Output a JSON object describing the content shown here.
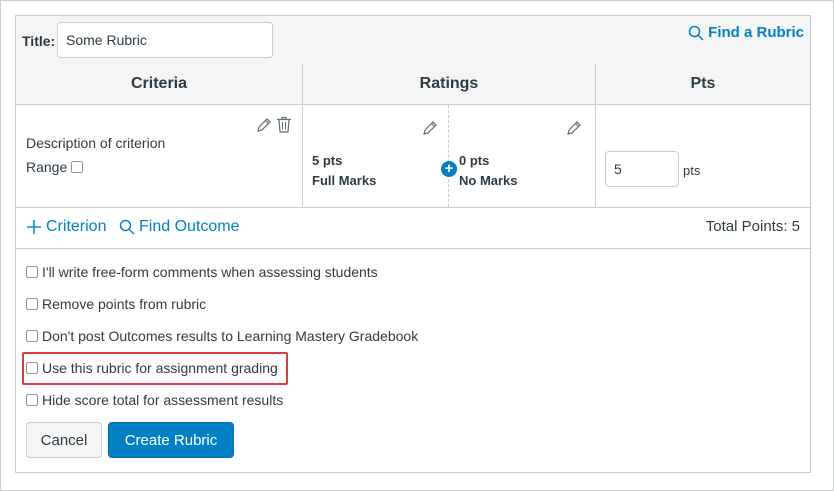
{
  "rubric": {
    "title_label": "Title:",
    "title_value": "Some Rubric",
    "find_rubric_label": "Find a Rubric"
  },
  "table": {
    "headers": {
      "criteria": "Criteria",
      "ratings": "Ratings",
      "pts": "Pts"
    },
    "criterion": {
      "description": "Description of criterion",
      "range_label": "Range",
      "ratings": [
        {
          "points": "5 pts",
          "description": "Full Marks"
        },
        {
          "points": "0 pts",
          "description": "No Marks"
        }
      ],
      "points_value": "5",
      "points_unit": "pts"
    }
  },
  "actions": {
    "add_criterion_label": "Criterion",
    "find_outcome_label": "Find Outcome",
    "total_points_text": "Total Points: 5"
  },
  "options": [
    {
      "label": "I'll write free-form comments when assessing students",
      "checked": false
    },
    {
      "label": "Remove points from rubric",
      "checked": false
    },
    {
      "label": "Don't post Outcomes results to Learning Mastery Gradebook",
      "checked": false
    },
    {
      "label": "Use this rubric for assignment grading",
      "checked": false,
      "highlighted": true
    },
    {
      "label": "Hide score total for assessment results",
      "checked": false
    }
  ],
  "buttons": {
    "cancel": "Cancel",
    "create": "Create Rubric"
  },
  "colors": {
    "accent": "#0081c4",
    "highlight": "#e03e3e",
    "border": "#c7cdd1"
  },
  "icons": [
    "search-icon",
    "pencil-icon",
    "trash-icon",
    "plus-icon",
    "plus-circle-icon"
  ]
}
